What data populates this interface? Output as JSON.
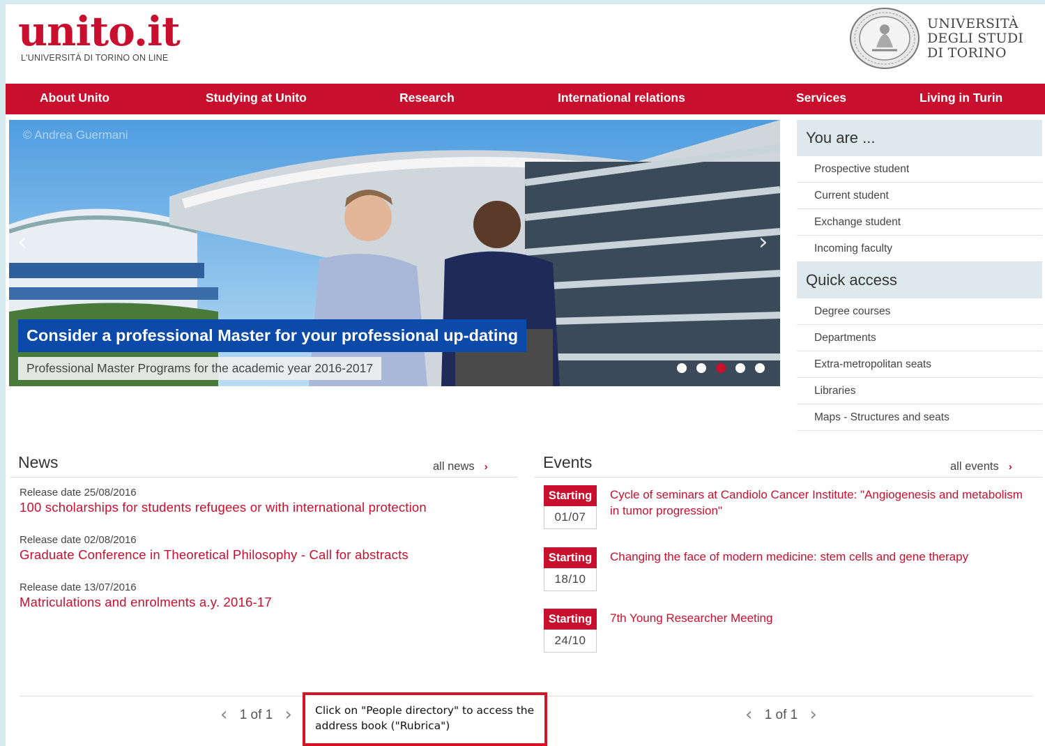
{
  "header": {
    "logo_main": "unito.it",
    "logo_sub": "L'UNIVERSITÀ DI TORINO ON LINE",
    "university_name": [
      "UNIVERSITÀ",
      "DEGLI STUDI",
      "DI TORINO"
    ]
  },
  "nav": [
    "About Unito",
    "Studying at Unito",
    "Research",
    "International relations",
    "Services",
    "Living in Turin"
  ],
  "carousel": {
    "credit": "© Andrea Guermani",
    "title": "Consider a professional Master for your professional up-dating",
    "subtitle": "Professional Master Programs for the academic year 2016-2017",
    "prev": "‹",
    "next": "›",
    "slide_count": 5,
    "active_slide": 3
  },
  "sidebar": {
    "you_are_title": "You are ...",
    "you_are": [
      "Prospective student",
      "Current student",
      "Exchange student",
      "Incoming faculty"
    ],
    "quick_access_title": "Quick access",
    "quick_access": [
      "Degree courses",
      "Departments",
      "Extra-metropolitan seats",
      "Libraries",
      "Maps - Structures and seats"
    ]
  },
  "news": {
    "title": "News",
    "all_link": "all news",
    "items": [
      {
        "date": "Release date 25/08/2016",
        "title": "100 scholarships for students refugees or with international protection"
      },
      {
        "date": "Release date 02/08/2016",
        "title": "Graduate Conference in Theoretical Philosophy - Call for abstracts"
      },
      {
        "date": "Release date 13/07/2016",
        "title": "Matriculations and enrolments a.y. 2016-17"
      }
    ],
    "pager": "1 of 1"
  },
  "events": {
    "title": "Events",
    "all_link": "all events",
    "items": [
      {
        "badge": "Starting",
        "date": "01/07",
        "title": "Cycle of seminars at Candiolo Cancer Institute: \"Angiogenesis and metabolism in tumor progression\""
      },
      {
        "badge": "Starting",
        "date": "18/10",
        "title": "Changing the face of modern medicine: stem cells and gene therapy"
      },
      {
        "badge": "Starting",
        "date": "24/10",
        "title": "7th Young Researcher Meeting"
      }
    ],
    "pager": "1 of 1"
  },
  "annotation": "Click on \"People directory\" to access the address book (\"Rubrica\")",
  "colors": {
    "brand_red": "#c8102e",
    "caption_blue": "#0b4aa8",
    "sidebar_head_bg": "#dde9ec"
  }
}
